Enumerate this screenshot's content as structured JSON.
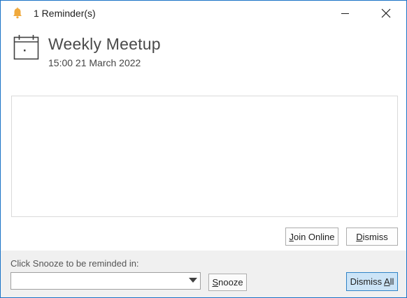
{
  "window": {
    "title": "1 Reminder(s)",
    "icons": {
      "title": "bell-icon",
      "minimize": "minimize-icon",
      "close": "close-icon"
    }
  },
  "reminder": {
    "icon": "calendar-icon",
    "subject": "Weekly Meetup",
    "datetime": "15:00 21 March 2022",
    "notes": ""
  },
  "actions": {
    "join_online": {
      "prefix": "",
      "mnemonic": "J",
      "rest": "oin Online"
    },
    "dismiss": {
      "prefix": "",
      "mnemonic": "D",
      "rest": "ismiss"
    }
  },
  "footer": {
    "snooze_prompt": "Click Snooze to be reminded in:",
    "snooze_selected": "",
    "snooze": {
      "prefix": "",
      "mnemonic": "S",
      "rest": "nooze"
    },
    "dismiss_all": {
      "prefix": "Dismiss ",
      "mnemonic": "A",
      "rest": "ll"
    }
  },
  "colors": {
    "border": "#1a73c7",
    "bell": "#f0a93c",
    "footer_bg": "#f0f0f0",
    "dismiss_all_bg": "#cce4f7"
  }
}
